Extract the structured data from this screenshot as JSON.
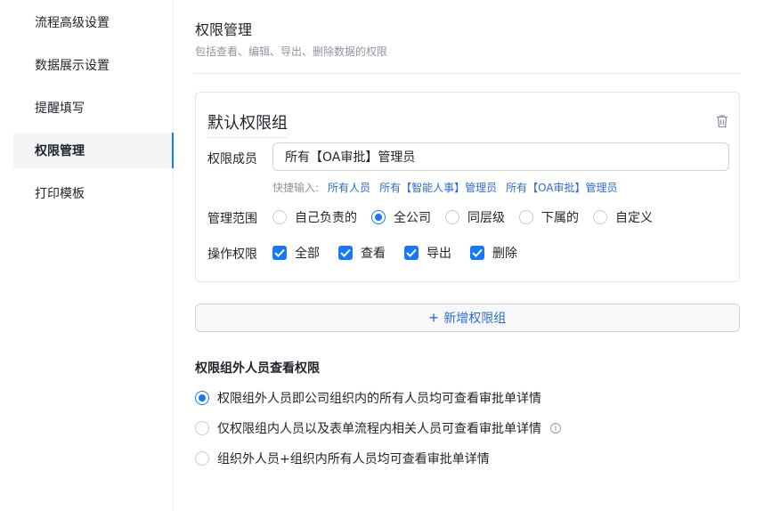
{
  "sidebar": {
    "items": [
      {
        "label": "流程高级设置"
      },
      {
        "label": "数据展示设置"
      },
      {
        "label": "提醒填写"
      },
      {
        "label": "权限管理",
        "active": true
      },
      {
        "label": "打印模板"
      }
    ]
  },
  "main": {
    "title": "权限管理",
    "subtitle": "包括查看、编辑、导出、删除数据的权限"
  },
  "group": {
    "name": "默认权限组",
    "trash_icon": "trash-icon",
    "members_label": "权限成员",
    "members_value": "所有【OA审批】管理员",
    "quick_label": "快捷输入:",
    "quick_links": [
      "所有人员",
      "所有【智能人事】管理员",
      "所有【OA审批】管理员"
    ],
    "scope_label": "管理范围",
    "scope_options": [
      "自己负责的",
      "全公司",
      "同层级",
      "下属的",
      "自定义"
    ],
    "scope_selected": "全公司",
    "ops_label": "操作权限",
    "ops_options": [
      "全部",
      "查看",
      "导出",
      "删除"
    ],
    "ops_checked": [
      "全部",
      "查看",
      "导出",
      "删除"
    ]
  },
  "add_group": {
    "label": "新增权限组",
    "icon": "plus-icon"
  },
  "outside": {
    "title": "权限组外人员查看权限",
    "options": [
      "权限组外人员即公司组织内的所有人员均可查看审批单详情",
      "仅权限组内人员以及表单流程内相关人员可查看审批单详情",
      "组织外人员+组织内所有人员均可查看审批单详情"
    ],
    "selected_index": 0,
    "info_icon": "info-icon"
  },
  "colors": {
    "accent": "#1677ff",
    "link": "#2f6bd8",
    "muted": "#8f959e"
  }
}
